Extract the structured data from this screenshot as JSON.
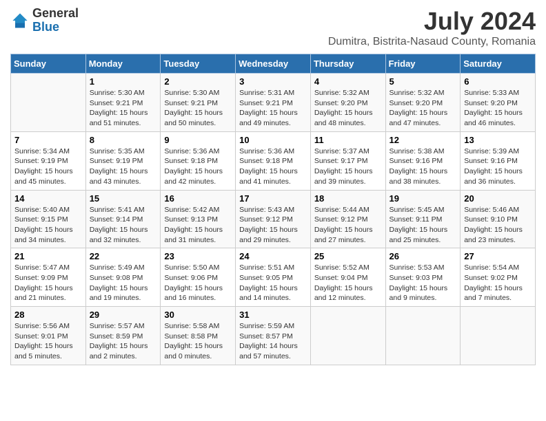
{
  "header": {
    "logo_general": "General",
    "logo_blue": "Blue",
    "main_title": "July 2024",
    "subtitle": "Dumitra, Bistrita-Nasaud County, Romania"
  },
  "days_of_week": [
    "Sunday",
    "Monday",
    "Tuesday",
    "Wednesday",
    "Thursday",
    "Friday",
    "Saturday"
  ],
  "weeks": [
    [
      {
        "day": "",
        "info": ""
      },
      {
        "day": "1",
        "info": "Sunrise: 5:30 AM\nSunset: 9:21 PM\nDaylight: 15 hours\nand 51 minutes."
      },
      {
        "day": "2",
        "info": "Sunrise: 5:30 AM\nSunset: 9:21 PM\nDaylight: 15 hours\nand 50 minutes."
      },
      {
        "day": "3",
        "info": "Sunrise: 5:31 AM\nSunset: 9:21 PM\nDaylight: 15 hours\nand 49 minutes."
      },
      {
        "day": "4",
        "info": "Sunrise: 5:32 AM\nSunset: 9:20 PM\nDaylight: 15 hours\nand 48 minutes."
      },
      {
        "day": "5",
        "info": "Sunrise: 5:32 AM\nSunset: 9:20 PM\nDaylight: 15 hours\nand 47 minutes."
      },
      {
        "day": "6",
        "info": "Sunrise: 5:33 AM\nSunset: 9:20 PM\nDaylight: 15 hours\nand 46 minutes."
      }
    ],
    [
      {
        "day": "7",
        "info": "Sunrise: 5:34 AM\nSunset: 9:19 PM\nDaylight: 15 hours\nand 45 minutes."
      },
      {
        "day": "8",
        "info": "Sunrise: 5:35 AM\nSunset: 9:19 PM\nDaylight: 15 hours\nand 43 minutes."
      },
      {
        "day": "9",
        "info": "Sunrise: 5:36 AM\nSunset: 9:18 PM\nDaylight: 15 hours\nand 42 minutes."
      },
      {
        "day": "10",
        "info": "Sunrise: 5:36 AM\nSunset: 9:18 PM\nDaylight: 15 hours\nand 41 minutes."
      },
      {
        "day": "11",
        "info": "Sunrise: 5:37 AM\nSunset: 9:17 PM\nDaylight: 15 hours\nand 39 minutes."
      },
      {
        "day": "12",
        "info": "Sunrise: 5:38 AM\nSunset: 9:16 PM\nDaylight: 15 hours\nand 38 minutes."
      },
      {
        "day": "13",
        "info": "Sunrise: 5:39 AM\nSunset: 9:16 PM\nDaylight: 15 hours\nand 36 minutes."
      }
    ],
    [
      {
        "day": "14",
        "info": "Sunrise: 5:40 AM\nSunset: 9:15 PM\nDaylight: 15 hours\nand 34 minutes."
      },
      {
        "day": "15",
        "info": "Sunrise: 5:41 AM\nSunset: 9:14 PM\nDaylight: 15 hours\nand 32 minutes."
      },
      {
        "day": "16",
        "info": "Sunrise: 5:42 AM\nSunset: 9:13 PM\nDaylight: 15 hours\nand 31 minutes."
      },
      {
        "day": "17",
        "info": "Sunrise: 5:43 AM\nSunset: 9:12 PM\nDaylight: 15 hours\nand 29 minutes."
      },
      {
        "day": "18",
        "info": "Sunrise: 5:44 AM\nSunset: 9:12 PM\nDaylight: 15 hours\nand 27 minutes."
      },
      {
        "day": "19",
        "info": "Sunrise: 5:45 AM\nSunset: 9:11 PM\nDaylight: 15 hours\nand 25 minutes."
      },
      {
        "day": "20",
        "info": "Sunrise: 5:46 AM\nSunset: 9:10 PM\nDaylight: 15 hours\nand 23 minutes."
      }
    ],
    [
      {
        "day": "21",
        "info": "Sunrise: 5:47 AM\nSunset: 9:09 PM\nDaylight: 15 hours\nand 21 minutes."
      },
      {
        "day": "22",
        "info": "Sunrise: 5:49 AM\nSunset: 9:08 PM\nDaylight: 15 hours\nand 19 minutes."
      },
      {
        "day": "23",
        "info": "Sunrise: 5:50 AM\nSunset: 9:06 PM\nDaylight: 15 hours\nand 16 minutes."
      },
      {
        "day": "24",
        "info": "Sunrise: 5:51 AM\nSunset: 9:05 PM\nDaylight: 15 hours\nand 14 minutes."
      },
      {
        "day": "25",
        "info": "Sunrise: 5:52 AM\nSunset: 9:04 PM\nDaylight: 15 hours\nand 12 minutes."
      },
      {
        "day": "26",
        "info": "Sunrise: 5:53 AM\nSunset: 9:03 PM\nDaylight: 15 hours\nand 9 minutes."
      },
      {
        "day": "27",
        "info": "Sunrise: 5:54 AM\nSunset: 9:02 PM\nDaylight: 15 hours\nand 7 minutes."
      }
    ],
    [
      {
        "day": "28",
        "info": "Sunrise: 5:56 AM\nSunset: 9:01 PM\nDaylight: 15 hours\nand 5 minutes."
      },
      {
        "day": "29",
        "info": "Sunrise: 5:57 AM\nSunset: 8:59 PM\nDaylight: 15 hours\nand 2 minutes."
      },
      {
        "day": "30",
        "info": "Sunrise: 5:58 AM\nSunset: 8:58 PM\nDaylight: 15 hours\nand 0 minutes."
      },
      {
        "day": "31",
        "info": "Sunrise: 5:59 AM\nSunset: 8:57 PM\nDaylight: 14 hours\nand 57 minutes."
      },
      {
        "day": "",
        "info": ""
      },
      {
        "day": "",
        "info": ""
      },
      {
        "day": "",
        "info": ""
      }
    ]
  ]
}
